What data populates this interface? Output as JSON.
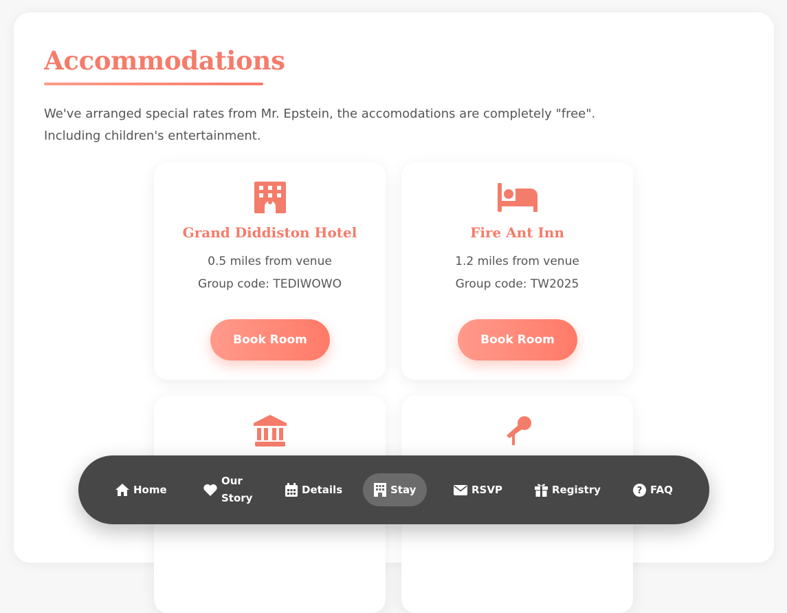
{
  "page": {
    "title": "Accommodations",
    "intro_line1": "We've arranged special rates from Mr. Epstein, the accomodations are completely \"free\".",
    "intro_line2": "Including children's entertainment."
  },
  "colors": {
    "accent": "#f47c6a",
    "button_gradient_start": "#ff9a8b",
    "button_gradient_end": "#ff7a68",
    "nav_bg": "#474747",
    "nav_active_bg": "#6b6b6b"
  },
  "cards": [
    {
      "icon": "hotel-icon",
      "name": "Grand Diddiston Hotel",
      "distance": "0.5 miles from venue",
      "code": "Group code: TEDIWOWO",
      "button": "Book Room"
    },
    {
      "icon": "bed-icon",
      "name": "Fire Ant Inn",
      "distance": "1.2 miles from venue",
      "code": "Group code: TW2025",
      "button": "Book Room"
    },
    {
      "icon": "landmark-icon"
    },
    {
      "icon": "microphone-icon"
    }
  ],
  "nav": {
    "items": [
      {
        "label": "Home",
        "icon": "home-icon"
      },
      {
        "label_line1": "Our",
        "label_line2": "Story",
        "icon": "heart-icon"
      },
      {
        "label": "Details",
        "icon": "calendar-icon"
      },
      {
        "label": "Stay",
        "icon": "building-icon",
        "active": true
      },
      {
        "label": "RSVP",
        "icon": "envelope-icon"
      },
      {
        "label": "Registry",
        "icon": "gift-icon"
      },
      {
        "label": "FAQ",
        "icon": "question-circle-icon"
      }
    ]
  }
}
